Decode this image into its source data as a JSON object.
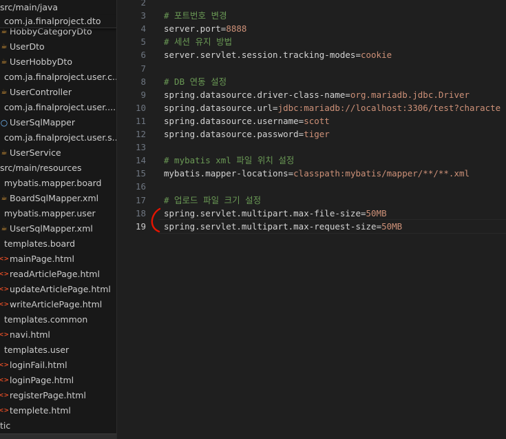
{
  "explorer": {
    "items": [
      {
        "label": "src/main/java",
        "kind": "folder",
        "icon": ""
      },
      {
        "label": "HobbyCategoryDto",
        "kind": "java",
        "icon": "java-icon"
      },
      {
        "label": "UserDto",
        "kind": "java",
        "icon": "java-icon"
      },
      {
        "label": "UserHobbyDto",
        "kind": "java",
        "icon": "java-icon"
      },
      {
        "label": "com.ja.finalproject.user.c...",
        "kind": "package",
        "icon": ""
      },
      {
        "label": "UserController",
        "kind": "java",
        "icon": "java-icon"
      },
      {
        "label": "com.ja.finalproject.user....",
        "kind": "package",
        "icon": ""
      },
      {
        "label": "UserSqlMapper",
        "kind": "interface",
        "icon": "interface-icon"
      },
      {
        "label": "com.ja.finalproject.user.s...",
        "kind": "package",
        "icon": ""
      },
      {
        "label": "UserService",
        "kind": "java",
        "icon": "java-icon"
      },
      {
        "label": "src/main/resources",
        "kind": "folder",
        "icon": ""
      },
      {
        "label": "mybatis.mapper.board",
        "kind": "package",
        "icon": ""
      },
      {
        "label": "BoardSqlMapper.xml",
        "kind": "xml",
        "icon": "xml-icon"
      },
      {
        "label": "mybatis.mapper.user",
        "kind": "package",
        "icon": ""
      },
      {
        "label": "UserSqlMapper.xml",
        "kind": "xml",
        "icon": "xml-icon"
      },
      {
        "label": "templates.board",
        "kind": "package",
        "icon": ""
      },
      {
        "label": "mainPage.html",
        "kind": "html",
        "icon": "html-icon"
      },
      {
        "label": "readArticlePage.html",
        "kind": "html",
        "icon": "html-icon"
      },
      {
        "label": "updateArticlePage.html",
        "kind": "html",
        "icon": "html-icon"
      },
      {
        "label": "writeArticlePage.html",
        "kind": "html",
        "icon": "html-icon"
      },
      {
        "label": "templates.common",
        "kind": "package",
        "icon": ""
      },
      {
        "label": "navi.html",
        "kind": "html",
        "icon": "html-icon"
      },
      {
        "label": "templates.user",
        "kind": "package",
        "icon": ""
      },
      {
        "label": "loginFail.html",
        "kind": "html",
        "icon": "html-icon"
      },
      {
        "label": "loginPage.html",
        "kind": "html",
        "icon": "html-icon"
      },
      {
        "label": "registerPage.html",
        "kind": "html",
        "icon": "html-icon"
      },
      {
        "label": "templete.html",
        "kind": "html",
        "icon": "html-icon"
      },
      {
        "label": "tic",
        "kind": "folder",
        "icon": ""
      }
    ],
    "sticky_label": "com.ja.finalproject.dto"
  },
  "editor": {
    "lines": [
      {
        "n": "2",
        "segments": []
      },
      {
        "n": "3",
        "segments": [
          {
            "t": "c",
            "text": "# 포트번호 변경"
          }
        ]
      },
      {
        "n": "4",
        "segments": [
          {
            "t": "k",
            "text": "server.port"
          },
          {
            "t": "e",
            "text": "="
          },
          {
            "t": "v",
            "text": "8888"
          }
        ]
      },
      {
        "n": "5",
        "segments": [
          {
            "t": "c",
            "text": "# 세션 유지 방법"
          }
        ]
      },
      {
        "n": "6",
        "segments": [
          {
            "t": "k",
            "text": "server.servlet.session.tracking-modes"
          },
          {
            "t": "e",
            "text": "="
          },
          {
            "t": "v",
            "text": "cookie"
          }
        ]
      },
      {
        "n": "7",
        "segments": []
      },
      {
        "n": "8",
        "segments": [
          {
            "t": "c",
            "text": "# DB 연동 설정"
          }
        ]
      },
      {
        "n": "9",
        "segments": [
          {
            "t": "k",
            "text": "spring.datasource.driver-class-name"
          },
          {
            "t": "e",
            "text": "="
          },
          {
            "t": "v",
            "text": "org.mariadb.jdbc.Driver"
          }
        ]
      },
      {
        "n": "10",
        "segments": [
          {
            "t": "k",
            "text": "spring.datasource.url"
          },
          {
            "t": "e",
            "text": "="
          },
          {
            "t": "v",
            "text": "jdbc:mariadb://localhost:3306/test?characte"
          }
        ]
      },
      {
        "n": "11",
        "segments": [
          {
            "t": "k",
            "text": "spring.datasource.username"
          },
          {
            "t": "e",
            "text": "="
          },
          {
            "t": "v",
            "text": "scott"
          }
        ]
      },
      {
        "n": "12",
        "segments": [
          {
            "t": "k",
            "text": "spring.datasource.password"
          },
          {
            "t": "e",
            "text": "="
          },
          {
            "t": "v",
            "text": "tiger"
          }
        ]
      },
      {
        "n": "13",
        "segments": []
      },
      {
        "n": "14",
        "segments": [
          {
            "t": "c",
            "text": "# mybatis xml 파일 위치 설정"
          }
        ]
      },
      {
        "n": "15",
        "segments": [
          {
            "t": "k",
            "text": "mybatis.mapper-locations"
          },
          {
            "t": "e",
            "text": "="
          },
          {
            "t": "v",
            "text": "classpath:mybatis/mapper/**/**.xml"
          }
        ]
      },
      {
        "n": "16",
        "segments": []
      },
      {
        "n": "17",
        "segments": [
          {
            "t": "c",
            "text": "# 업로드 파일 크기 설정"
          }
        ]
      },
      {
        "n": "18",
        "segments": [
          {
            "t": "k",
            "text": "spring.servlet.multipart.max-file-size"
          },
          {
            "t": "e",
            "text": "="
          },
          {
            "t": "v",
            "text": "50MB"
          }
        ]
      },
      {
        "n": "19",
        "segments": [
          {
            "t": "k",
            "text": "spring.servlet.multipart.max-request-size"
          },
          {
            "t": "e",
            "text": "="
          },
          {
            "t": "v",
            "text": "50MB"
          }
        ]
      }
    ],
    "active_line": "19"
  },
  "colors": {
    "comment": "#6a9955",
    "key": "#d4d4d4",
    "value": "#ce9178",
    "annotation": "#e51400"
  }
}
